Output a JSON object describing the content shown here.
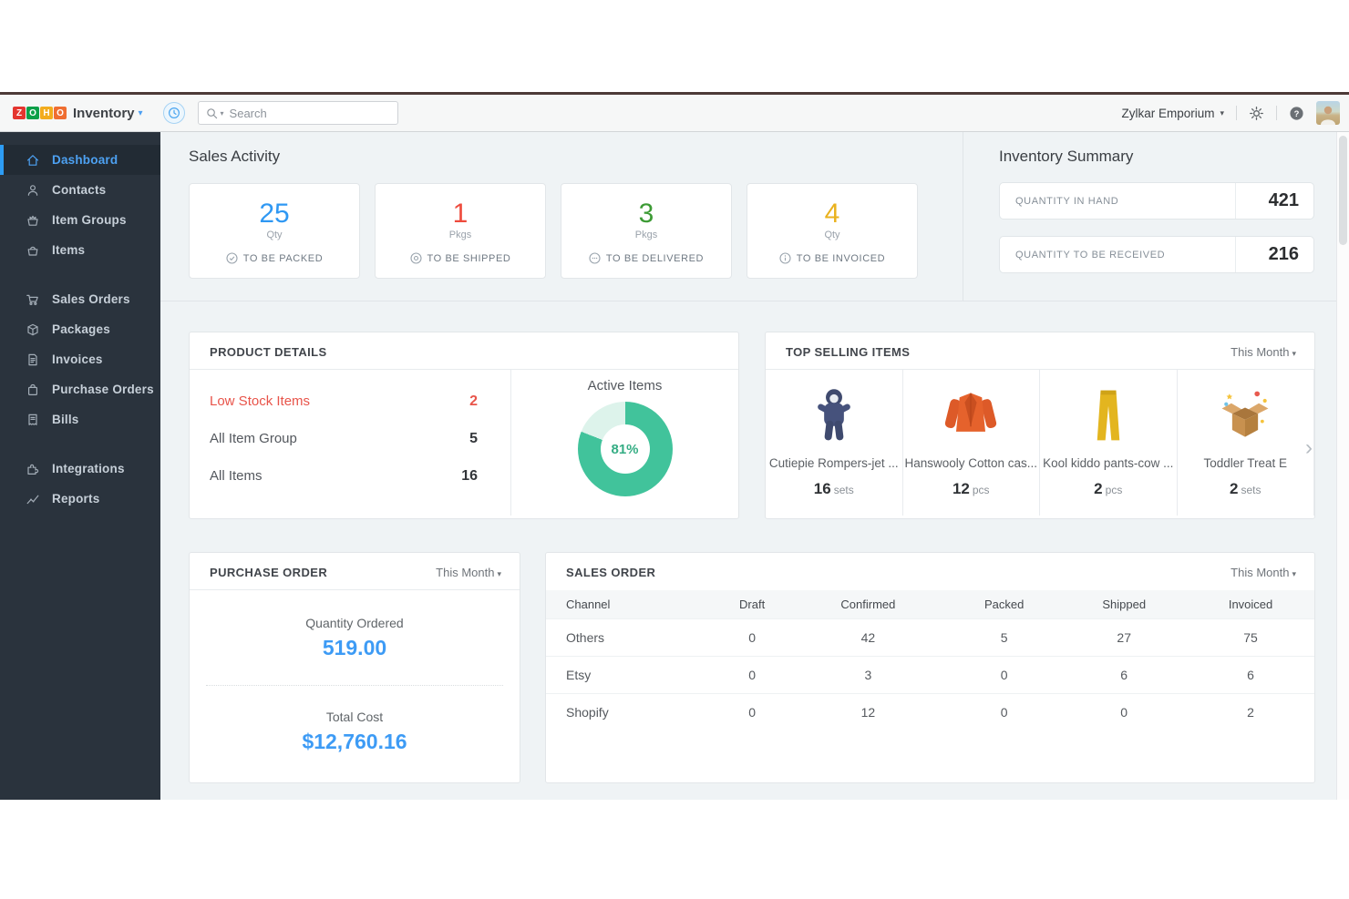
{
  "topbar": {
    "logo": {
      "tiles": [
        {
          "letter": "Z",
          "color": "#e4352f"
        },
        {
          "letter": "O",
          "color": "#0ba049"
        },
        {
          "letter": "H",
          "color": "#f2ac1d"
        },
        {
          "letter": "O",
          "color": "#ef6e31"
        }
      ],
      "product_name": "Inventory"
    },
    "search": {
      "placeholder": "Search"
    },
    "org_name": "Zylkar Emporium"
  },
  "sidebar": {
    "items": [
      {
        "label": "Dashboard"
      },
      {
        "label": "Contacts"
      },
      {
        "label": "Item Groups"
      },
      {
        "label": "Items"
      },
      {
        "label": "Sales Orders"
      },
      {
        "label": "Packages"
      },
      {
        "label": "Invoices"
      },
      {
        "label": "Purchase Orders"
      },
      {
        "label": "Bills"
      },
      {
        "label": "Integrations"
      },
      {
        "label": "Reports"
      }
    ]
  },
  "sales_activity": {
    "title": "Sales Activity",
    "cards": [
      {
        "value": "25",
        "unit": "Qty",
        "label": "TO BE PACKED",
        "color": "#2f98f3"
      },
      {
        "value": "1",
        "unit": "Pkgs",
        "label": "TO BE SHIPPED",
        "color": "#ee4b3d"
      },
      {
        "value": "3",
        "unit": "Pkgs",
        "label": "TO BE DELIVERED",
        "color": "#3d9b35"
      },
      {
        "value": "4",
        "unit": "Qty",
        "label": "TO BE INVOICED",
        "color": "#eab21e"
      }
    ]
  },
  "inventory_summary": {
    "title": "Inventory Summary",
    "rows": [
      {
        "label": "QUANTITY IN HAND",
        "value": "421"
      },
      {
        "label": "QUANTITY TO BE RECEIVED",
        "value": "216"
      }
    ]
  },
  "product_details": {
    "title": "PRODUCT DETAILS",
    "rows": [
      {
        "label": "Low Stock Items",
        "value": "2",
        "color": "#e8544a"
      },
      {
        "label": "All Item Group",
        "value": "5"
      },
      {
        "label": "All Items",
        "value": "16"
      }
    ],
    "active_items": {
      "title": "Active Items",
      "percent_label": "81%",
      "percent": 81,
      "ring_color": "#41c39b",
      "rest_color": "#ddf3eb",
      "text_color": "#35ad84"
    }
  },
  "top_selling": {
    "title": "TOP SELLING ITEMS",
    "period": "This Month",
    "items": [
      {
        "name": "Cutiepie Rompers-jet ...",
        "qty": "16",
        "unit": "sets",
        "image": "baby-romper"
      },
      {
        "name": "Hanswooly Cotton cas...",
        "qty": "12",
        "unit": "pcs",
        "image": "orange-cardigan"
      },
      {
        "name": "Kool kiddo pants-cow ...",
        "qty": "2",
        "unit": "pcs",
        "image": "yellow-pants"
      },
      {
        "name": "Toddler Treat E",
        "qty": "2",
        "unit": "sets",
        "image": "gift-box"
      }
    ]
  },
  "purchase_order": {
    "title": "PURCHASE ORDER",
    "period": "This Month",
    "value_color": "#3d9bf5",
    "metrics": [
      {
        "label": "Quantity Ordered",
        "value": "519.00"
      },
      {
        "label": "Total Cost",
        "value": "$12,760.16"
      }
    ]
  },
  "sales_order": {
    "title": "SALES ORDER",
    "period": "This Month",
    "columns": [
      "Channel",
      "Draft",
      "Confirmed",
      "Packed",
      "Shipped",
      "Invoiced"
    ],
    "rows": [
      [
        "Others",
        "0",
        "42",
        "5",
        "27",
        "75"
      ],
      [
        "Etsy",
        "0",
        "3",
        "0",
        "6",
        "6"
      ],
      [
        "Shopify",
        "0",
        "12",
        "0",
        "0",
        "2"
      ]
    ]
  }
}
